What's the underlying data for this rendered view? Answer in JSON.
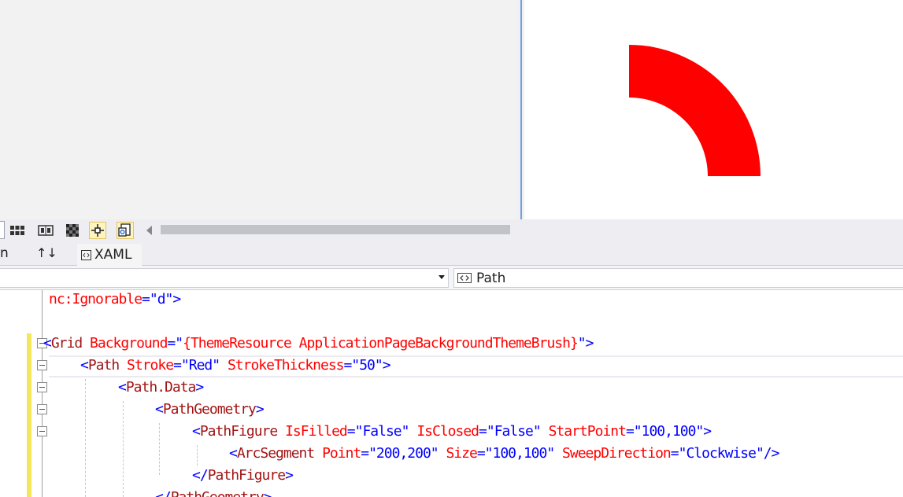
{
  "toolbar": {
    "buttons": [
      "grid-view-icon",
      "snap-grid-icon",
      "checkerboard-icon",
      "snap-guides-icon",
      "annotations-icon"
    ]
  },
  "tabs": {
    "design_partial": "n",
    "swap_label": "↑↓",
    "xaml_label": "XAML"
  },
  "navbar": {
    "right_label": "Path"
  },
  "colors": {
    "arc": "#ff0000",
    "change_marker": "#f5e55a",
    "splitter": "#7aa0d6"
  },
  "code": {
    "l1": {
      "tag": "nc:Ignorable",
      "val": "=\"d\">"
    },
    "l2": {
      "lt": "<",
      "tag": "Grid",
      "sp": " ",
      "attr": "Background",
      "eq": "=\"",
      "val": "{ThemeResource ApplicationPageBackgroundThemeBrush}",
      "end": "\">"
    },
    "l3": {
      "lt": "<",
      "tag": "Path",
      "a1": "Stroke",
      "v1": "=\"Red\"",
      "a2": "StrokeThickness",
      "v2": "=\"50\">"
    },
    "l4": {
      "lt": "<",
      "tag": "Path.Data",
      "gt": ">"
    },
    "l5": {
      "lt": "<",
      "tag": "PathGeometry",
      "gt": ">"
    },
    "l6": {
      "lt": "<",
      "tag": "PathFigure",
      "a1": "IsFilled",
      "v1": "=\"False\"",
      "a2": "IsClosed",
      "v2": "=\"False\"",
      "a3": "StartPoint",
      "v3": "=\"100,100\">"
    },
    "l7": {
      "lt": "<",
      "tag": "ArcSegment",
      "a1": "Point",
      "v1": "=\"200,200\"",
      "a2": "Size",
      "v2": "=\"100,100\"",
      "a3": "SweepDirection",
      "v3": "=\"Clockwise\"/>"
    },
    "l8": {
      "lt": "</",
      "tag": "PathFigure",
      "gt": ">"
    },
    "l9": {
      "lt": "</",
      "tag": "PathGeometry",
      "gt": ">"
    }
  }
}
